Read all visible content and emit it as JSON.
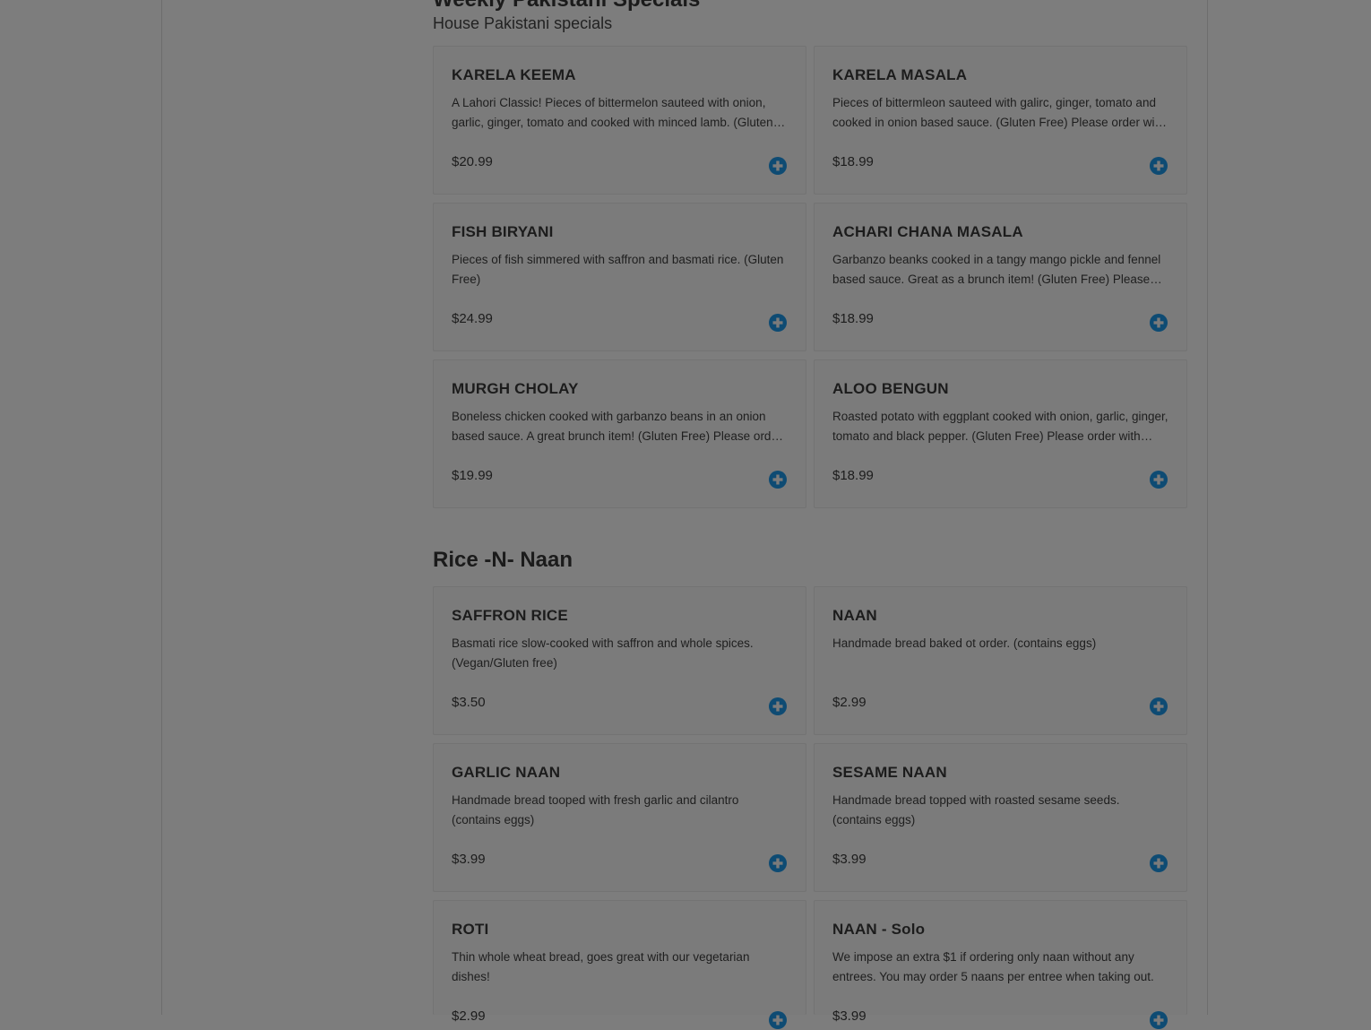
{
  "sections": [
    {
      "title": "Weekly Pakistani Specials",
      "subtitle": "House Pakistani specials",
      "items": [
        {
          "name": "KARELA KEEMA",
          "description": "A Lahori Classic! Pieces of bittermelon sauteed with onion, garlic, ginger, tomato and cooked with minced lamb. (Gluten Free)",
          "price": "$20.99"
        },
        {
          "name": "KARELA MASALA",
          "description": "Pieces of bittermleon sauteed with galirc, ginger, tomato and cooked in onion based sauce. (Gluten Free) Please order with naan or rice.",
          "price": "$18.99"
        },
        {
          "name": "FISH BIRYANI",
          "description": "Pieces of fish simmered with saffron and basmati rice. (Gluten Free)",
          "price": "$24.99"
        },
        {
          "name": "ACHARI CHANA MASALA",
          "description": "Garbanzo beanks cooked in a tangy mango pickle and fennel based sauce. Great as a brunch item! (Gluten Free) Please order with naan or rice.",
          "price": "$18.99"
        },
        {
          "name": "MURGH CHOLAY",
          "description": "Boneless chicken cooked with garbanzo beans in an onion based sauce. A great brunch item! (Gluten Free) Please order with naan or rice.",
          "price": "$19.99"
        },
        {
          "name": "ALOO BENGUN",
          "description": "Roasted potato with eggplant cooked with onion, garlic, ginger, tomato and black pepper. (Gluten Free) Please order with naan or rice.",
          "price": "$18.99"
        }
      ]
    },
    {
      "title": "Rice -N- Naan",
      "subtitle": "",
      "items": [
        {
          "name": "SAFFRON RICE",
          "description": "Basmati rice slow-cooked with saffron and whole spices. (Vegan/Gluten free)",
          "price": "$3.50"
        },
        {
          "name": "NAAN",
          "description": "Handmade bread baked ot order. (contains eggs)",
          "price": "$2.99"
        },
        {
          "name": "GARLIC NAAN",
          "description": "Handmade bread tooped with fresh garlic and cilantro (contains eggs)",
          "price": "$3.99"
        },
        {
          "name": "SESAME NAAN",
          "description": "Handmade bread topped with roasted sesame seeds. (contains eggs)",
          "price": "$3.99"
        },
        {
          "name": "ROTI",
          "description": "Thin whole wheat bread, goes great with our vegetarian dishes!",
          "price": "$2.99"
        },
        {
          "name": "NAAN - Solo",
          "description": "We impose an extra $1 if ordering only naan without any entrees. You may order 5 naans per entree when taking out.",
          "price": "$3.99"
        }
      ]
    }
  ],
  "icons": {
    "add": "plus-circle-icon"
  },
  "colors": {
    "accent": "#0e4b73",
    "background": "#7d7d7d"
  }
}
